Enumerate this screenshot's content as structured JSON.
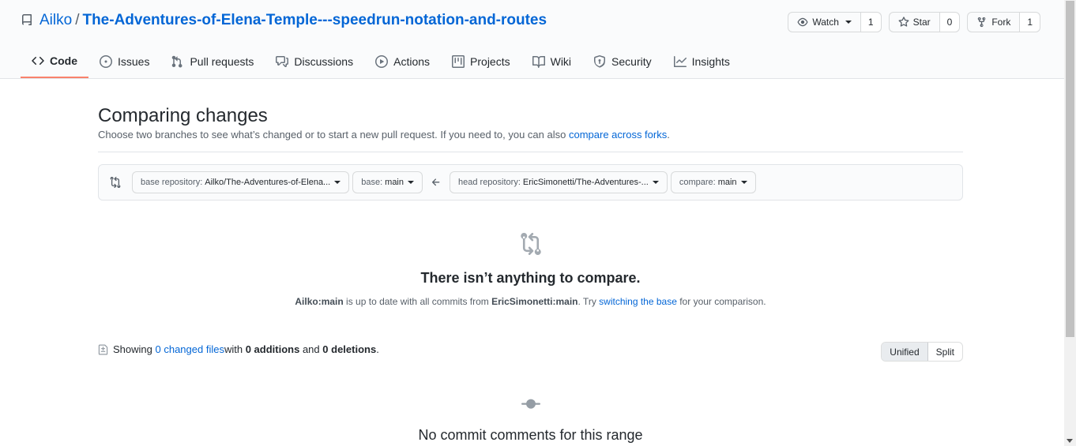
{
  "repo": {
    "owner": "Ailko",
    "separator": "/",
    "name": "The-Adventures-of-Elena-Temple---speedrun-notation-and-routes"
  },
  "actions": {
    "watch_label": "Watch",
    "watch_count": "1",
    "star_label": "Star",
    "star_count": "0",
    "fork_label": "Fork",
    "fork_count": "1"
  },
  "nav": {
    "items": [
      {
        "label": "Code",
        "icon": "code-icon"
      },
      {
        "label": "Issues",
        "icon": "issue-icon"
      },
      {
        "label": "Pull requests",
        "icon": "pull-request-icon"
      },
      {
        "label": "Discussions",
        "icon": "discussion-icon"
      },
      {
        "label": "Actions",
        "icon": "play-icon"
      },
      {
        "label": "Projects",
        "icon": "project-icon"
      },
      {
        "label": "Wiki",
        "icon": "book-icon"
      },
      {
        "label": "Security",
        "icon": "shield-icon"
      },
      {
        "label": "Insights",
        "icon": "graph-icon"
      }
    ],
    "active": "Code"
  },
  "compare": {
    "title": "Comparing changes",
    "desc_prefix": "Choose two branches to see what’s changed or to start a new pull request. If you need to, you can also ",
    "desc_link": "compare across forks",
    "desc_suffix": ".",
    "base_repo_label": "base repository:",
    "base_repo_value": "Ailko/The-Adventures-of-Elena...",
    "base_label": "base:",
    "base_value": "main",
    "head_repo_label": "head repository:",
    "head_repo_value": "EricSimonetti/The-Adventures-...",
    "compare_label": "compare:",
    "compare_value": "main"
  },
  "blank": {
    "title": "There isn’t anything to compare.",
    "base_ref": "Ailko:main",
    "text1": " is up to date with all commits from ",
    "head_ref": "EricSimonetti:main",
    "text2": ". Try ",
    "link": "switching the base",
    "text3": " for your comparison."
  },
  "summary": {
    "showing": "Showing ",
    "files_link": "0 changed files",
    "with": " with ",
    "additions": "0 additions",
    "and": " and ",
    "deletions": "0 deletions",
    "period": "."
  },
  "diff_toggle": {
    "unified": "Unified",
    "split": "Split"
  },
  "comments": {
    "title": "No commit comments for this range"
  },
  "colors": {
    "link": "#0366d6",
    "active_tab_underline": "#f9826c",
    "header_bg": "#fafbfc"
  }
}
